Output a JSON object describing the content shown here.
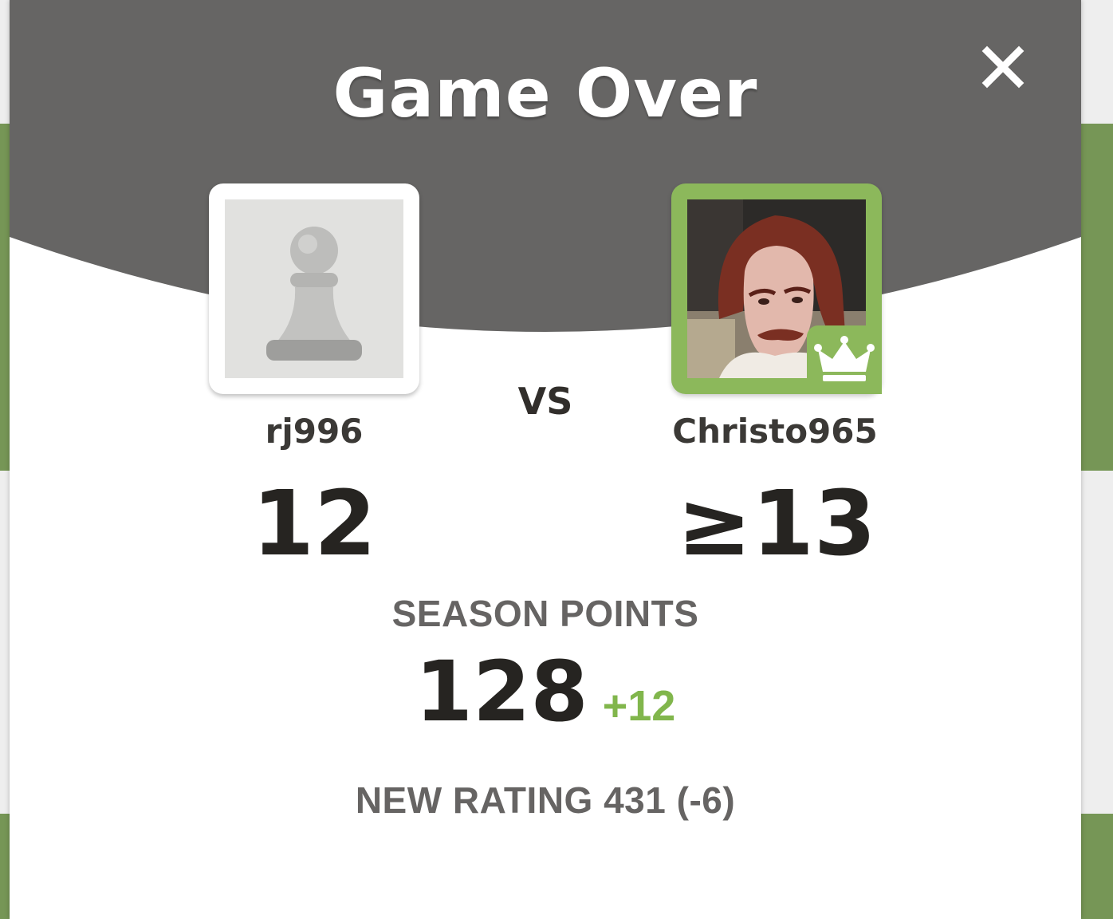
{
  "modal": {
    "title": "Game Over",
    "close_icon": "close-icon"
  },
  "colors": {
    "header": "#666564",
    "accent_green": "#81b64c",
    "avatar_border_green": "#8cb85b",
    "text_dark": "#262421",
    "text_muted": "#666463"
  },
  "players": {
    "left": {
      "username": "rj996",
      "score": "12",
      "avatar_icon": "pawn-icon"
    },
    "vs_label": "VS",
    "right": {
      "username": "Christo965",
      "score": "≥13",
      "avatar_icon": "user-photo",
      "badge_icon": "crown-icon"
    }
  },
  "season": {
    "label": "SEASON POINTS",
    "value": "128",
    "delta": "+12"
  },
  "rating": {
    "text": "NEW RATING 431 (-6)"
  }
}
